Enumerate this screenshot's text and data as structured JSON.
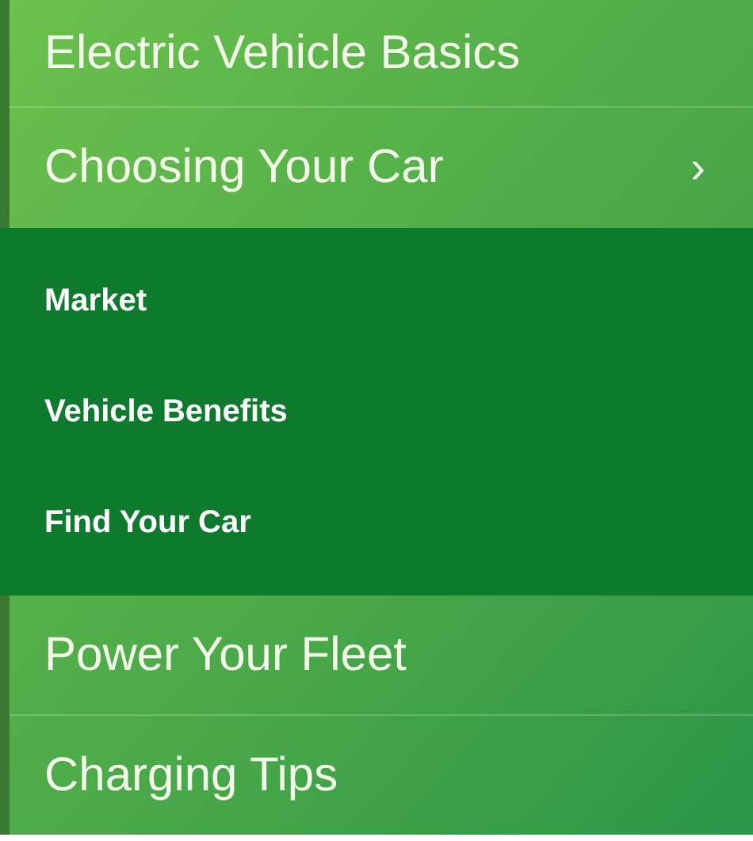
{
  "menu": {
    "items": [
      {
        "label": "Electric Vehicle Basics",
        "expanded": false
      },
      {
        "label": "Choosing Your Car",
        "chevron": "›",
        "expanded": true,
        "children": [
          {
            "label": "Market"
          },
          {
            "label": "Vehicle Benefits"
          },
          {
            "label": "Find Your Car"
          }
        ]
      },
      {
        "label": "Power Your Fleet",
        "expanded": false
      },
      {
        "label": "Charging Tips",
        "expanded": false
      }
    ]
  }
}
